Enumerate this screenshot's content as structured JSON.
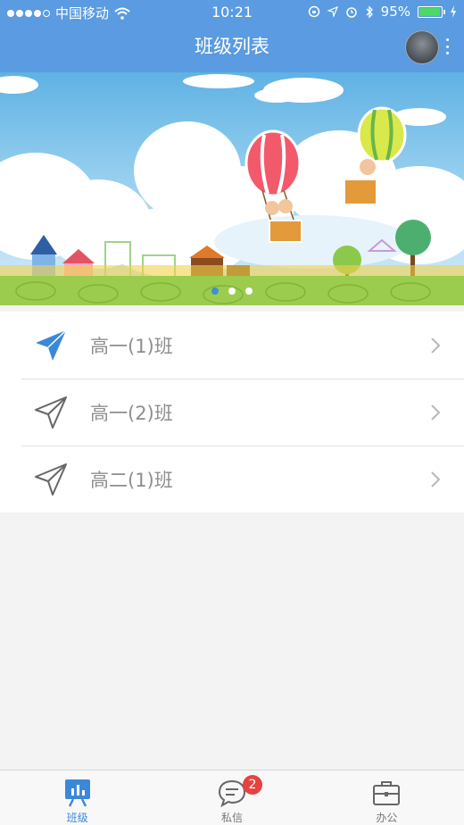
{
  "status_bar": {
    "carrier": "中国移动",
    "time": "10:21",
    "battery": "95%",
    "battery_level": 0.95,
    "battery_color": "#4cd964"
  },
  "header": {
    "title": "班级列表",
    "background": "#5a9be1"
  },
  "banner": {
    "page_count": 3,
    "active_page": 1
  },
  "classes": [
    {
      "label": "高一(1)班",
      "icon": "paper-plane-filled-icon"
    },
    {
      "label": "高一(2)班",
      "icon": "paper-plane-outline-icon"
    },
    {
      "label": "高二(1)班",
      "icon": "paper-plane-outline-icon"
    }
  ],
  "tabs": [
    {
      "label": "班级",
      "icon": "class-board-icon",
      "active": true
    },
    {
      "label": "私信",
      "icon": "chat-bubble-icon",
      "badge": "2"
    },
    {
      "label": "办公",
      "icon": "briefcase-icon"
    }
  ],
  "colors": {
    "accent": "#3c88d8",
    "badge": "#e64340"
  }
}
